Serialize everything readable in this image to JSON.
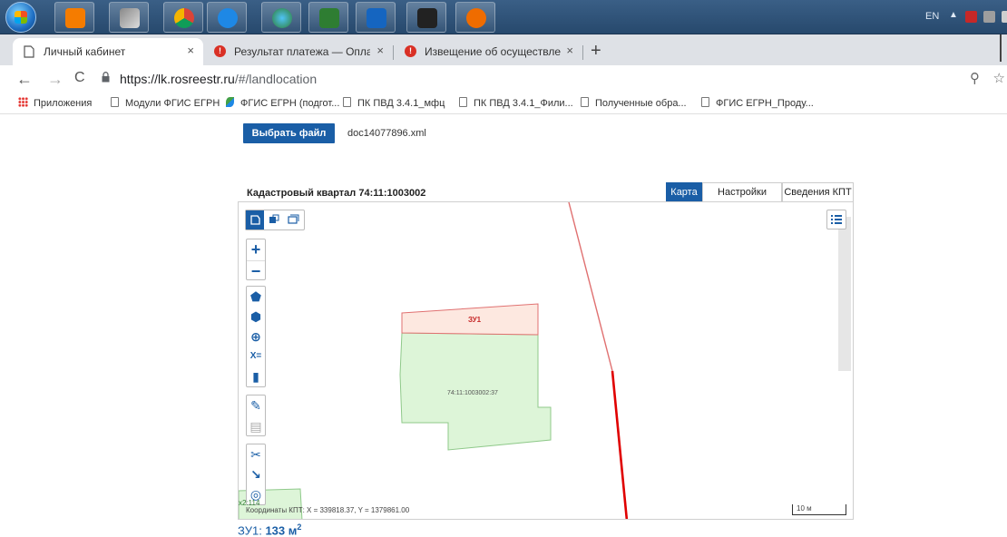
{
  "browser": {
    "tabs": [
      {
        "title": "Личный кабинет",
        "close": "×"
      },
      {
        "title": "Результат платежа — Оплата гос",
        "close": "×"
      },
      {
        "title": "Извещение об осуществлении",
        "close": "×"
      }
    ],
    "new_tab": "+",
    "url_domain": "https://lk.rosreestr.ru",
    "url_path": "/#/landlocation",
    "bookmarks": [
      "Приложения",
      "Модули ФГИС ЕГРН",
      "ФГИС ЕГРН (подгот...",
      "ПК ПВД 3.4.1_мфц",
      "ПК ПВД 3.4.1_Фили...",
      "Полученные обра...",
      "ФГИС ЕГРН_Проду..."
    ]
  },
  "taskbar": {
    "lang": "EN"
  },
  "page": {
    "choose_file_label": "Выбрать файл КПТ",
    "file_name": "doc14077896.xml",
    "quarter_title": "Кадастровый квартал 74:11:1003002",
    "tabs": [
      "Карта",
      "Настройки карты",
      "Сведения КПТ"
    ],
    "active_tab": 0
  },
  "map": {
    "parcel_new_label": "ЗУ1",
    "parcel_existing_label": "74:11:1003002:37",
    "edge_label": "х2:114",
    "coords_text": "Координаты КПТ: X = 339818.37, Y = 1379861.00",
    "scale_label": "10 м",
    "colors": {
      "new_parcel_fill": "#fde8e0",
      "new_parcel_stroke": "#e07070",
      "existing_parcel_fill": "#ddf5d8",
      "existing_parcel_stroke": "#8fc98a",
      "boundary_line": "#e00000",
      "accent": "#1a5ea6"
    }
  },
  "result": {
    "label": "ЗУ1:",
    "value": "133",
    "unit": "м",
    "unit_power": "2"
  }
}
